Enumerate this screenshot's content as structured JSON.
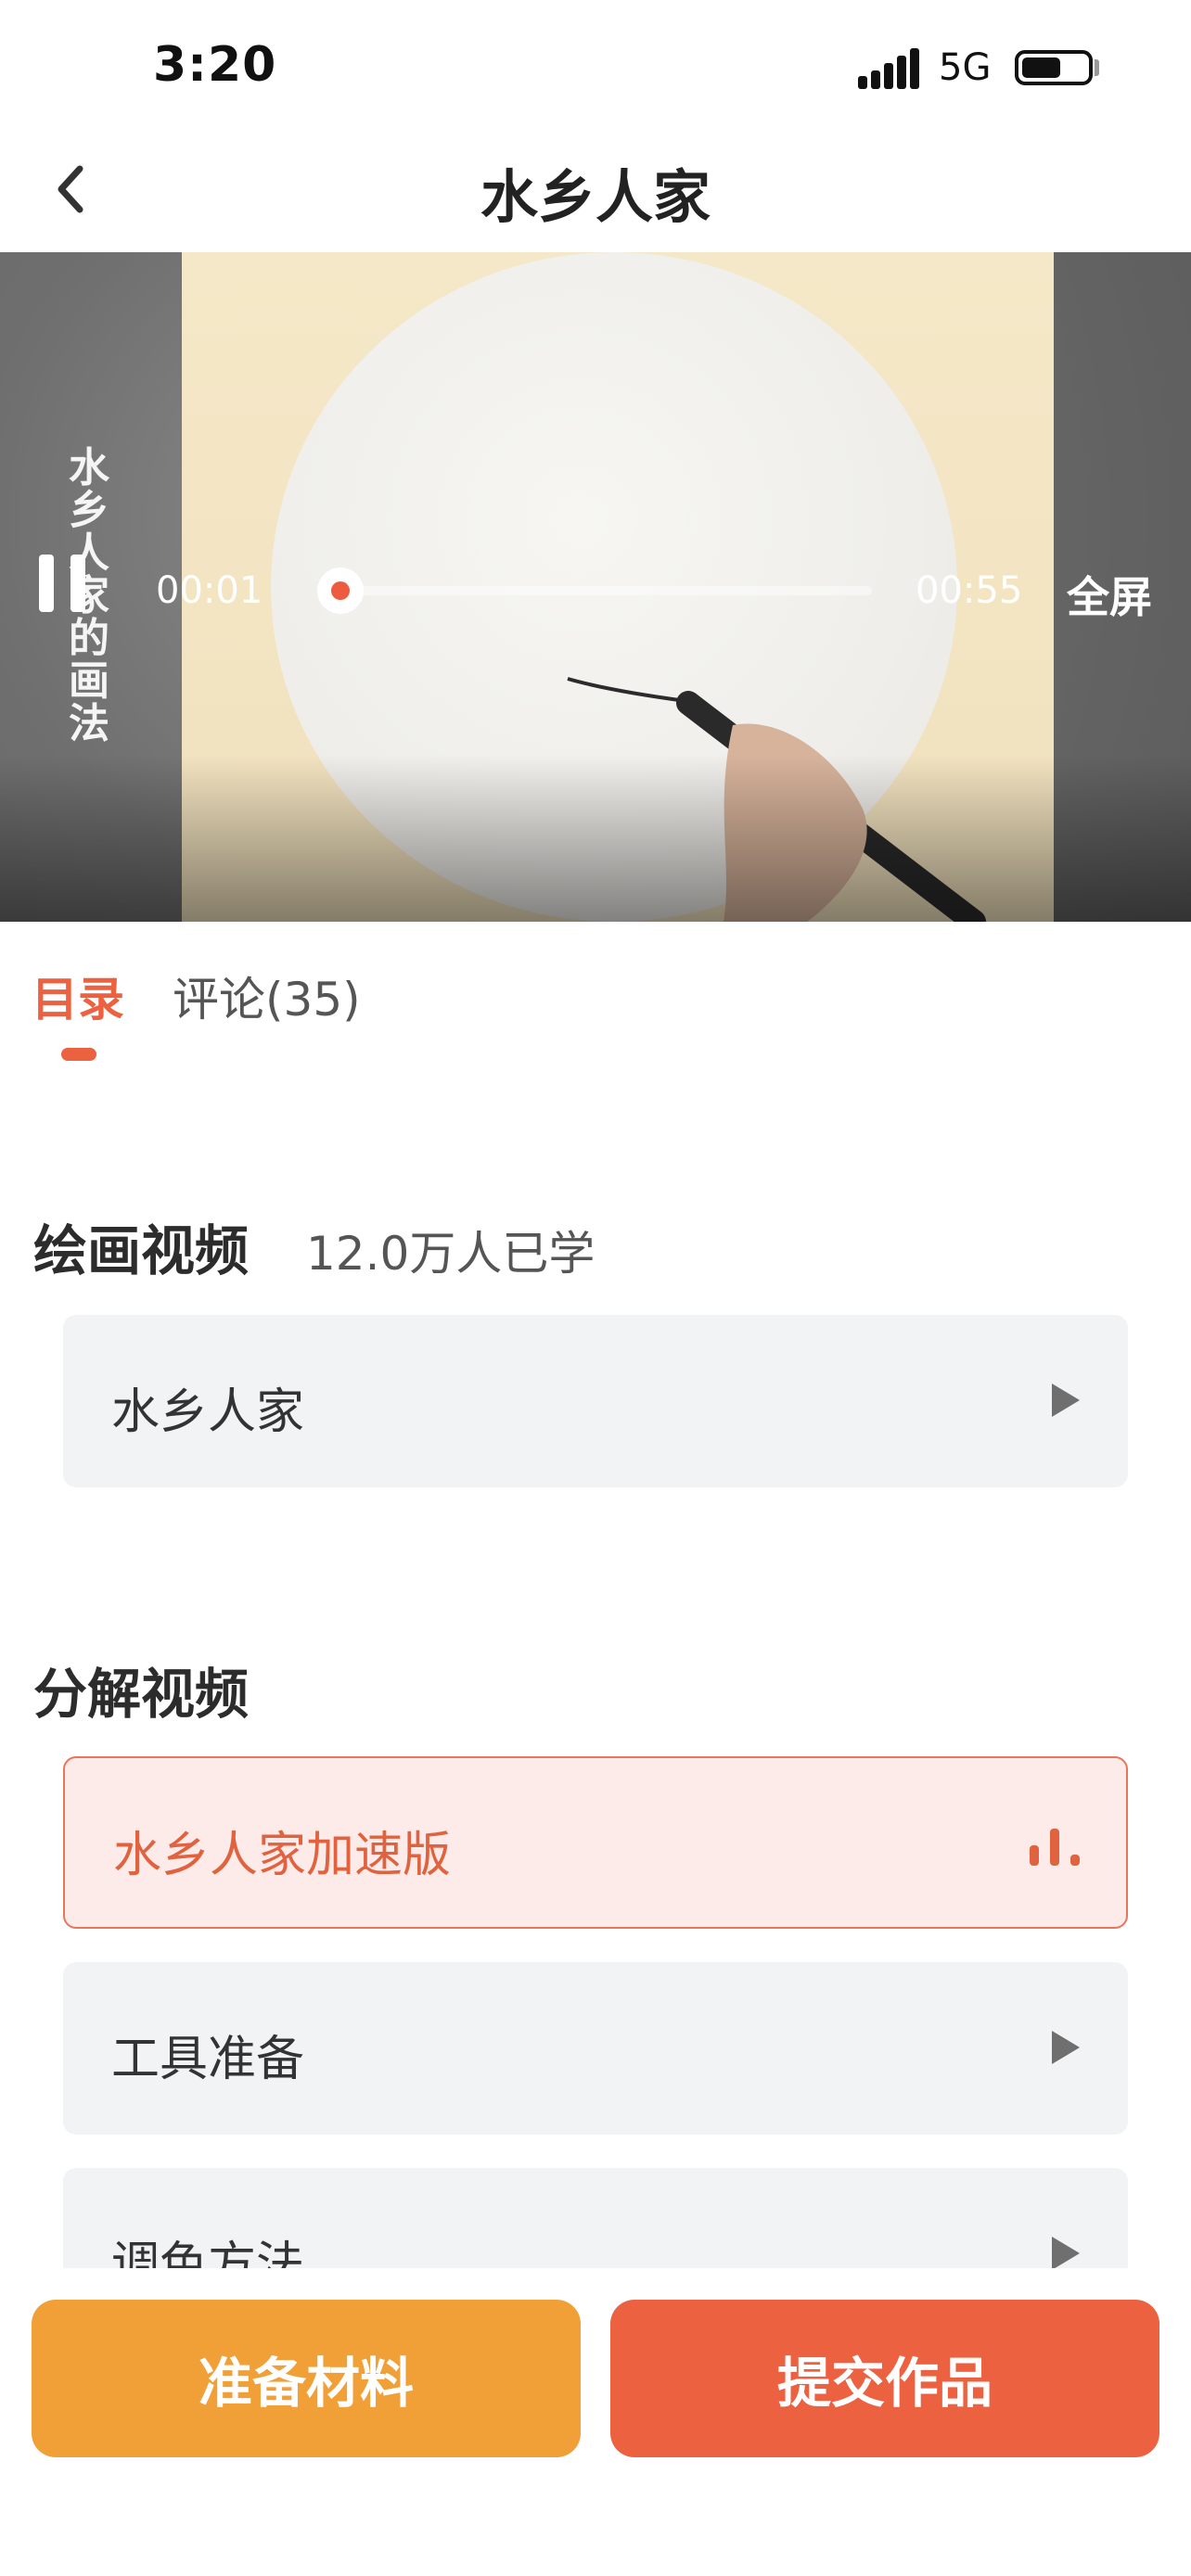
{
  "status_bar": {
    "time": "3:20",
    "network": "5G",
    "battery_level": 0.6
  },
  "nav": {
    "title": "水乡人家"
  },
  "video": {
    "side_title": "水乡人家的画法",
    "current_time": "00:01",
    "total_time": "00:55",
    "fullscreen_label": "全屏",
    "progress": 0.02
  },
  "tabs": {
    "catalog": "目录",
    "comments": "评论(35)"
  },
  "sections": {
    "painting": {
      "title": "绘画视频",
      "learners": "12.0万人已学",
      "items": [
        "水乡人家"
      ]
    },
    "breakdown": {
      "title": "分解视频",
      "items": [
        "水乡人家加速版",
        "工具准备",
        "调色方法"
      ]
    }
  },
  "buttons": {
    "prepare_materials": "准备材料",
    "submit_work": "提交作品"
  },
  "colors": {
    "accent": "#ec6140",
    "secondary": "#f0a036"
  }
}
